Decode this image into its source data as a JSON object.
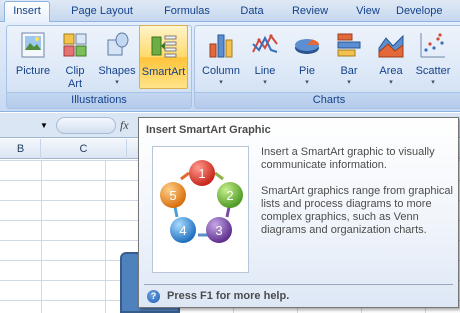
{
  "tabs": [
    {
      "label": "Insert",
      "active": true
    },
    {
      "label": "Page Layout"
    },
    {
      "label": "Formulas"
    },
    {
      "label": "Data"
    },
    {
      "label": "Review"
    },
    {
      "label": "View"
    },
    {
      "label": "Develope"
    }
  ],
  "ribbon": {
    "illustrations": {
      "label": "Illustrations",
      "buttons": [
        {
          "label": "Picture",
          "icon": "picture-icon"
        },
        {
          "label": "Clip Art",
          "icon": "clip-art-icon"
        },
        {
          "label": "Shapes",
          "icon": "shapes-icon"
        },
        {
          "label": "SmartArt",
          "icon": "smartart-icon",
          "highlighted": true
        }
      ]
    },
    "charts": {
      "label": "Charts",
      "buttons": [
        {
          "label": "Column",
          "icon": "column-chart-icon"
        },
        {
          "label": "Line",
          "icon": "line-chart-icon"
        },
        {
          "label": "Pie",
          "icon": "pie-chart-icon"
        },
        {
          "label": "Bar",
          "icon": "bar-chart-icon"
        },
        {
          "label": "Area",
          "icon": "area-chart-icon"
        },
        {
          "label": "Scatter",
          "icon": "scatter-chart-icon"
        }
      ]
    },
    "dropdown_glyph": "▾"
  },
  "formula_bar": {
    "fx": "fx"
  },
  "sheet": {
    "columns": [
      "B",
      "C"
    ]
  },
  "tooltip": {
    "title": "Insert SmartArt Graphic",
    "paragraphs": [
      "Insert a SmartArt graphic to visually communicate information.",
      "SmartArt graphics range from graphical lists and process diagrams to more complex graphics, such as Venn diagrams and organization charts."
    ],
    "help": "Press F1 for more help.",
    "preview_numbers": [
      "1",
      "2",
      "3",
      "4",
      "5"
    ]
  },
  "colors": {
    "ribbon_text": "#15428b",
    "highlight": "#ffd969",
    "circle_red": "#d9342b",
    "circle_green": "#6ab23c",
    "circle_purple": "#7a4aa6",
    "circle_blue": "#3a8fd2",
    "circle_orange": "#ef8a1c"
  }
}
